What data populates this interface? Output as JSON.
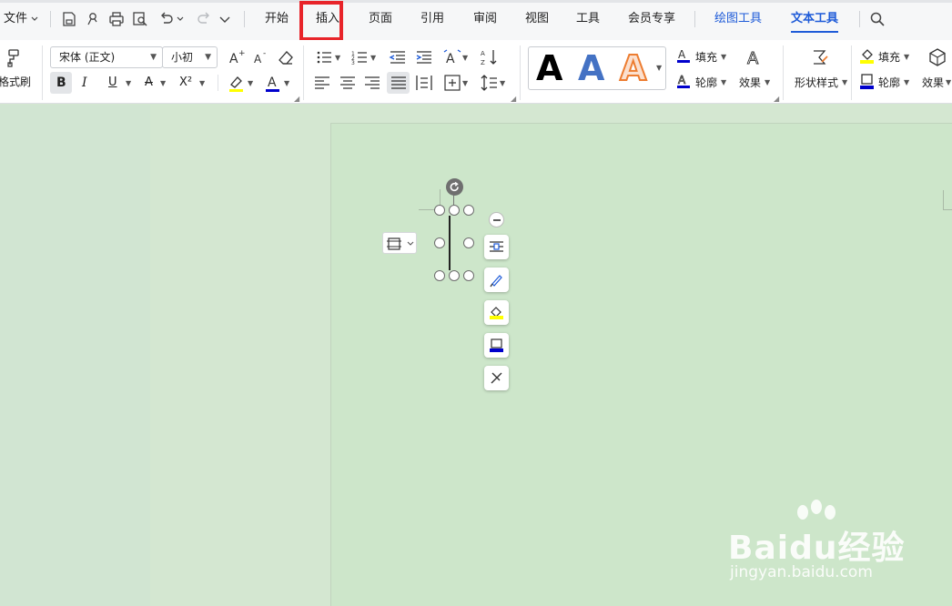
{
  "menubar": {
    "file_label": "文件",
    "tabs": [
      "开始",
      "插入",
      "页面",
      "引用",
      "审阅",
      "视图",
      "工具",
      "会员专享",
      "绘图工具",
      "文本工具"
    ],
    "active_tab": "文本工具"
  },
  "ribbon": {
    "format_painter_label": "格式刷",
    "font_name": "宋体 (正文)",
    "font_size": "小初",
    "bold_label": "B",
    "italic_label": "I",
    "underline_label": "U",
    "strike_label": "A",
    "superscript_label": "X²",
    "fill_label": "填充",
    "outline_label": "轮廓",
    "effects_label": "效果",
    "shape_style_label": "形状样式",
    "shape_fill_label": "填充",
    "shape_outline_label": "轮廓",
    "shape_effects_label": "效果",
    "gallery": [
      {
        "glyph": "A",
        "style": "black-fill",
        "color": "#000000"
      },
      {
        "glyph": "A",
        "style": "blue-fill",
        "color": "#4472c4"
      },
      {
        "glyph": "A",
        "style": "orange-outline",
        "color": "#ed7d31"
      }
    ]
  },
  "colors": {
    "accent_blue": "#1e5bd8",
    "highlight_red": "#e8242a",
    "doc_background": "#cde6ca",
    "underline_blue": "#0000cc",
    "highlight_yellow": "#ffff00"
  },
  "watermark": {
    "brand": "Baidu经验",
    "url": "jingyan.baidu.com"
  }
}
